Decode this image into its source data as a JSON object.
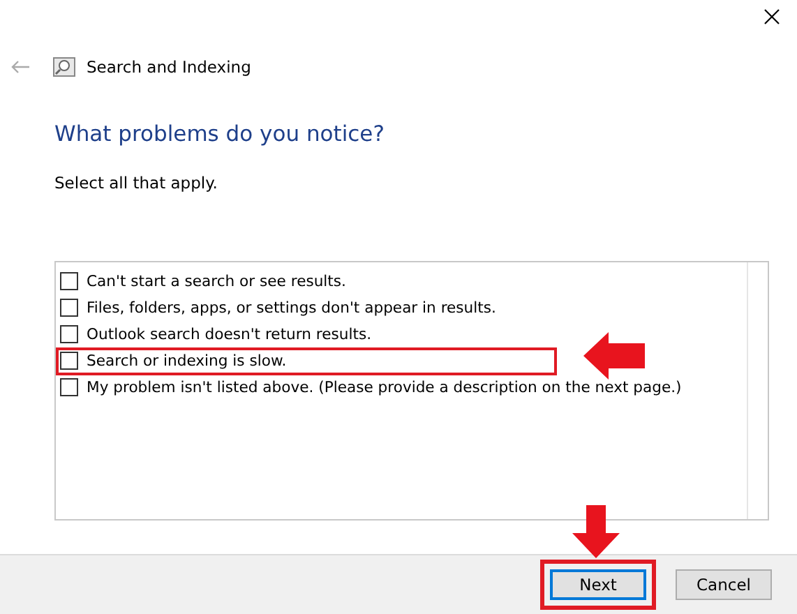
{
  "window": {
    "title": "Search and Indexing"
  },
  "heading": "What problems do you notice?",
  "instruction": "Select all that apply.",
  "problems": [
    {
      "label": "Can't start a search or see results.",
      "checked": false,
      "highlighted": false
    },
    {
      "label": "Files, folders, apps, or settings don't appear in results.",
      "checked": false,
      "highlighted": false
    },
    {
      "label": "Outlook search doesn't return results.",
      "checked": false,
      "highlighted": false
    },
    {
      "label": "Search or indexing is slow.",
      "checked": false,
      "highlighted": true
    },
    {
      "label": "My problem isn't listed above. (Please provide a description on the next page.)",
      "checked": false,
      "highlighted": false
    }
  ],
  "buttons": [
    {
      "label": "Next",
      "default": true,
      "highlighted": true
    },
    {
      "label": "Cancel",
      "default": false,
      "highlighted": false
    }
  ]
}
